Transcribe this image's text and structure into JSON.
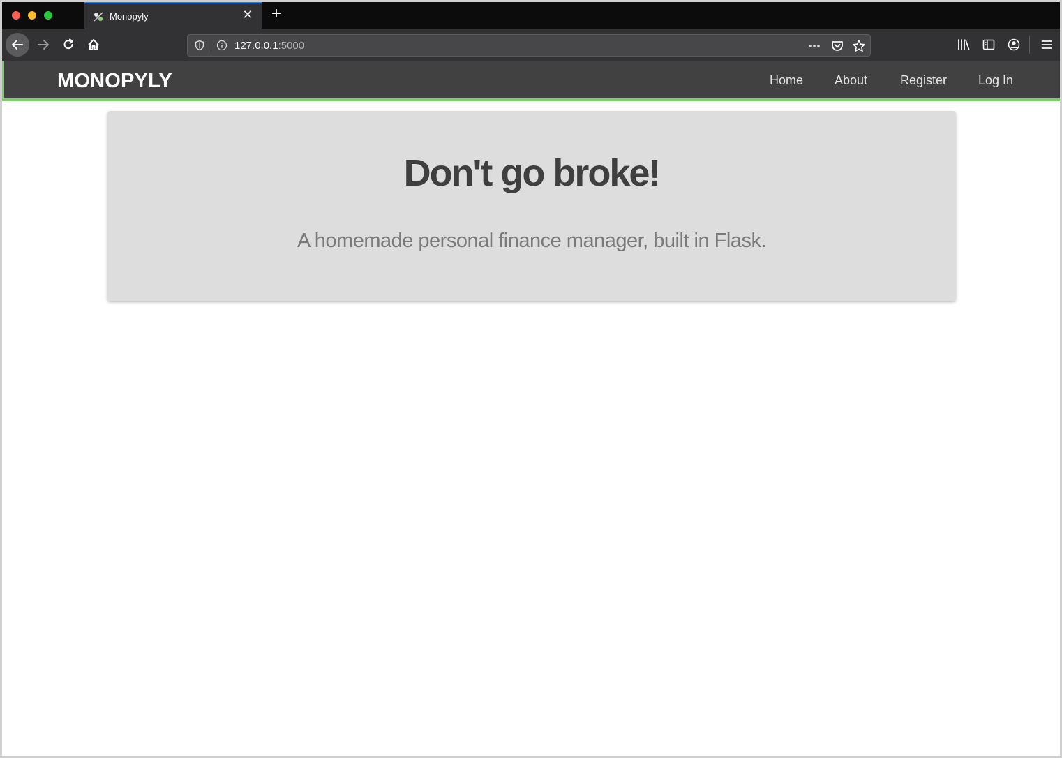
{
  "browser": {
    "tab": {
      "title": "Monopyly",
      "favicon": "monopyly-favicon"
    },
    "new_tab_label": "+",
    "tab_close_label": "✕",
    "url": {
      "host": "127.0.0.1",
      "port": ":5000"
    },
    "icons": [
      "back-arrow-icon",
      "forward-arrow-icon",
      "reload-icon",
      "home-icon",
      "shield-icon",
      "info-icon",
      "more-icon",
      "pocket-icon",
      "star-icon",
      "library-icon",
      "sidebar-icon",
      "account-icon",
      "menu-icon"
    ],
    "colors": {
      "tab_strip": "#0c0c0d",
      "toolbar": "#323234",
      "active_tab_accent": "#0a84ff"
    }
  },
  "site": {
    "brand": "MONOPYLY",
    "nav": {
      "home": "Home",
      "about": "About",
      "register": "Register",
      "login": "Log In"
    },
    "colors": {
      "navbar": "#414141",
      "accent": "#7ccc6b",
      "jumbotron": "#dddddd"
    }
  },
  "jumbotron": {
    "title": "Don't go broke!",
    "subtitle": "A homemade personal finance manager, built in Flask."
  }
}
